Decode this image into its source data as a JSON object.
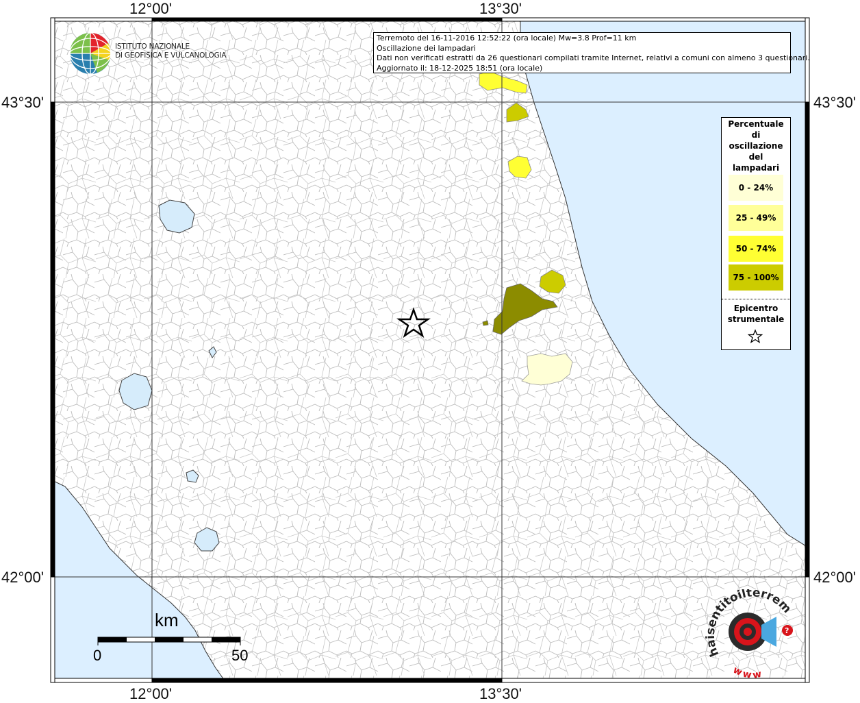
{
  "info": {
    "line1": "Terremoto del 16-11-2016 12:52:22 (ora locale) Mw=3.8 Prof=11 km",
    "line2": "Oscillazione dei lampadari",
    "line3": "Dati non verificati estratti da 26 questionari compilati tramite Internet, relativi a comuni con almeno 3 questionari.",
    "line4": "Aggiornato il: 18-12-2025 18:51 (ora locale)"
  },
  "institute": {
    "line1": "ISTITUTO NAZIONALE",
    "line2": "DI GEOFISICA E VULCANOLOGIA"
  },
  "axes": {
    "lon_left": "12°00'",
    "lon_right": "13°30'",
    "lat_top": "43°30'",
    "lat_bottom": "42°00'"
  },
  "legend": {
    "title": [
      "Percentuale",
      "di",
      "oscillazione",
      "del",
      "lampadari"
    ],
    "classes": [
      {
        "label": "0 - 24%",
        "color": "#ffffd6"
      },
      {
        "label": "25 - 49%",
        "color": "#ffff99"
      },
      {
        "label": "50 - 74%",
        "color": "#ffff33"
      },
      {
        "label": "75 - 100%",
        "color": "#cccc00"
      }
    ],
    "epicenter_title": [
      "Epicentro",
      "strumentale"
    ]
  },
  "scale": {
    "unit": "km",
    "start": "0",
    "end": "50"
  },
  "colors": {
    "sea": "#dcefff",
    "lake": "#d6ecfb",
    "boundary": "#bbbbbb",
    "class_dark": "#8c8c00"
  },
  "hst_logo": {
    "text": "haisentitoilterremoto.it",
    "www": "www"
  }
}
